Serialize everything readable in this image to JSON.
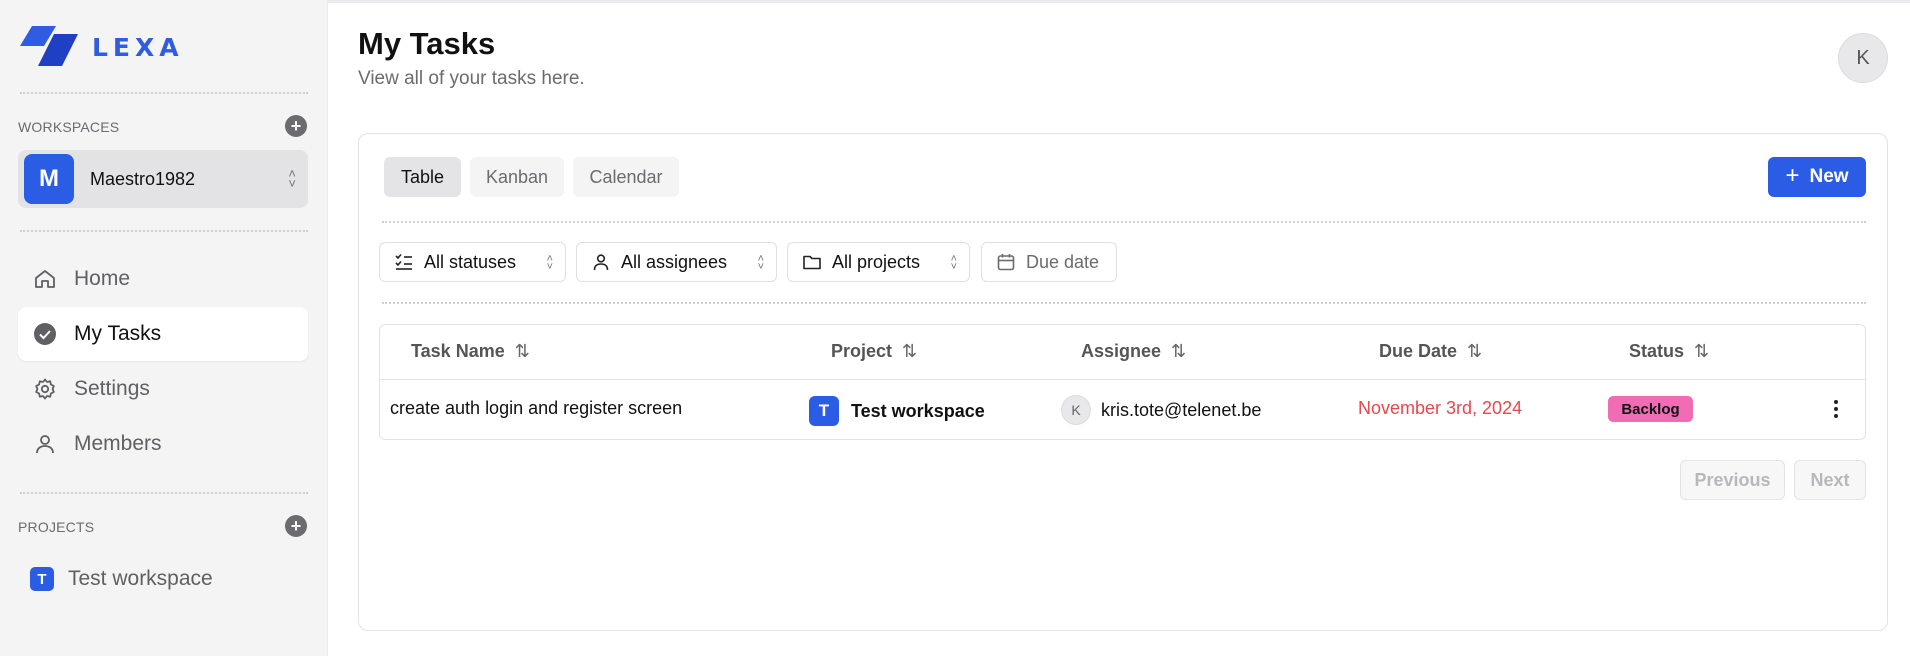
{
  "brand": {
    "name": "LEXA",
    "color": "#2f5ce0"
  },
  "sidebar": {
    "workspaces_label": "WORKSPACES",
    "workspace": {
      "initial": "M",
      "name": "Maestro1982"
    },
    "nav": [
      {
        "label": "Home",
        "icon": "home-icon"
      },
      {
        "label": "My Tasks",
        "icon": "check-circle-icon",
        "active": true
      },
      {
        "label": "Settings",
        "icon": "gear-icon"
      },
      {
        "label": "Members",
        "icon": "user-icon"
      }
    ],
    "projects_label": "PROJECTS",
    "projects": [
      {
        "initial": "T",
        "name": "Test workspace"
      }
    ]
  },
  "header": {
    "title": "My Tasks",
    "subtitle": "View all of your tasks here.",
    "user_initial": "K"
  },
  "tabs": [
    {
      "label": "Table",
      "active": true
    },
    {
      "label": "Kanban"
    },
    {
      "label": "Calendar"
    }
  ],
  "new_button": "New",
  "filters": {
    "status": "All statuses",
    "assignee": "All assignees",
    "project": "All projects",
    "due": "Due date"
  },
  "table": {
    "columns": [
      "Task Name",
      "Project",
      "Assignee",
      "Due Date",
      "Status"
    ],
    "rows": [
      {
        "task": "create auth login and register screen",
        "project_initial": "T",
        "project": "Test workspace",
        "assignee_initial": "K",
        "assignee": "kris.tote@telenet.be",
        "due": "November 3rd, 2024",
        "status": "Backlog"
      }
    ]
  },
  "pagination": {
    "previous": "Previous",
    "next": "Next"
  },
  "colors": {
    "accent": "#2a5ce6",
    "overdue": "#e5484d",
    "backlog_badge": "#f06db6"
  }
}
